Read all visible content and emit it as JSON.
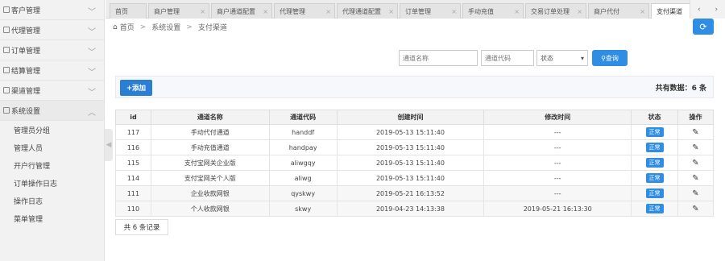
{
  "sidebar": {
    "groups": [
      {
        "label": "客户管理"
      },
      {
        "label": "代理管理"
      },
      {
        "label": "订单管理"
      },
      {
        "label": "结算管理"
      },
      {
        "label": "渠道管理"
      },
      {
        "label": "系统设置"
      }
    ],
    "submenu": [
      "管理员分组",
      "管理人员",
      "开户行管理",
      "订单操作日志",
      "操作日志",
      "菜单管理"
    ]
  },
  "tabs": [
    "首页",
    "商户管理",
    "商户通道配置",
    "代理管理",
    "代理通道配置",
    "订单管理",
    "手动充值",
    "交易订单处理",
    "商户代付",
    "支付渠道"
  ],
  "breadcrumb": [
    "首页",
    "系统设置",
    "支付渠道"
  ],
  "filters": {
    "name_placeholder": "通道名称",
    "code_placeholder": "通道代码",
    "status_value": "状态",
    "search_label": "查询"
  },
  "toolbar": {
    "add_label": "+添加",
    "total_label": "共有数据：6 条"
  },
  "table": {
    "columns": [
      "id",
      "通道名称",
      "通道代码",
      "创建时间",
      "修改时间",
      "状态",
      "操作"
    ],
    "rows": [
      {
        "id": "117",
        "name": "手动代付通道",
        "code": "handdf",
        "created": "2019-05-13 15:11:40",
        "modified": "---",
        "status": "正常"
      },
      {
        "id": "116",
        "name": "手动充值通道",
        "code": "handpay",
        "created": "2019-05-13 15:11:40",
        "modified": "---",
        "status": "正常"
      },
      {
        "id": "115",
        "name": "支付宝网关企业版",
        "code": "aliwgqy",
        "created": "2019-05-13 15:11:40",
        "modified": "---",
        "status": "正常"
      },
      {
        "id": "114",
        "name": "支付宝网关个人版",
        "code": "aliwg",
        "created": "2019-05-13 15:11:40",
        "modified": "---",
        "status": "正常"
      },
      {
        "id": "111",
        "name": "企业收款网银",
        "code": "qyskwy",
        "created": "2019-05-21 16:13:52",
        "modified": "---",
        "status": "正常"
      },
      {
        "id": "110",
        "name": "个人收款网银",
        "code": "skwy",
        "created": "2019-04-23 14:13:38",
        "modified": "2019-05-21 16:13:30",
        "status": "正常"
      }
    ]
  },
  "pager": {
    "label": "共 6 条记录"
  },
  "colors": {
    "primary": "#2f8ee4",
    "sidebar_bg": "#f2f2f2"
  }
}
